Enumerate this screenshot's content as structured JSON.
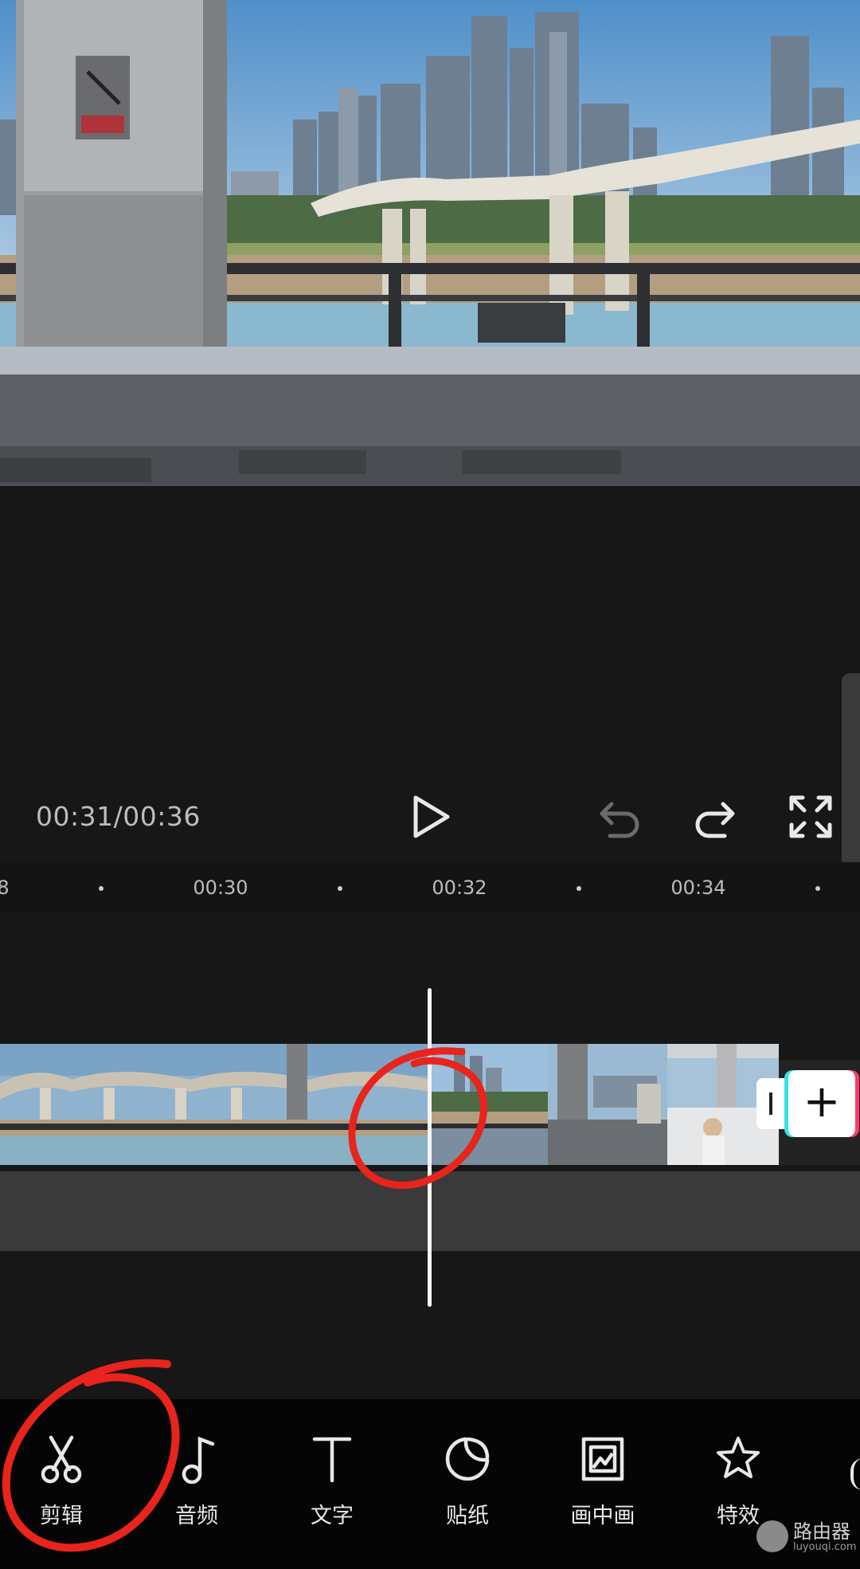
{
  "player": {
    "time": "00:31/00:36"
  },
  "ruler": {
    "labels": [
      "8",
      "00:30",
      "00:32",
      "00:34"
    ]
  },
  "toolbar": {
    "items": [
      {
        "label": "剪辑",
        "icon": "scissors-icon"
      },
      {
        "label": "音频",
        "icon": "music-note-icon"
      },
      {
        "label": "文字",
        "icon": "text-icon"
      },
      {
        "label": "贴纸",
        "icon": "sticker-icon"
      },
      {
        "label": "画中画",
        "icon": "picture-in-picture-icon"
      },
      {
        "label": "特效",
        "icon": "effects-star-icon"
      }
    ]
  },
  "add_clip": {
    "label": "+"
  },
  "watermark": {
    "name": "路由器",
    "domain": "luyouqi.com"
  },
  "colors": {
    "background": "#171717",
    "toolbar": "#050505",
    "annotation": "#e8241c",
    "accent_cyan": "#35e3e3",
    "accent_pink": "#ff3b6b"
  }
}
